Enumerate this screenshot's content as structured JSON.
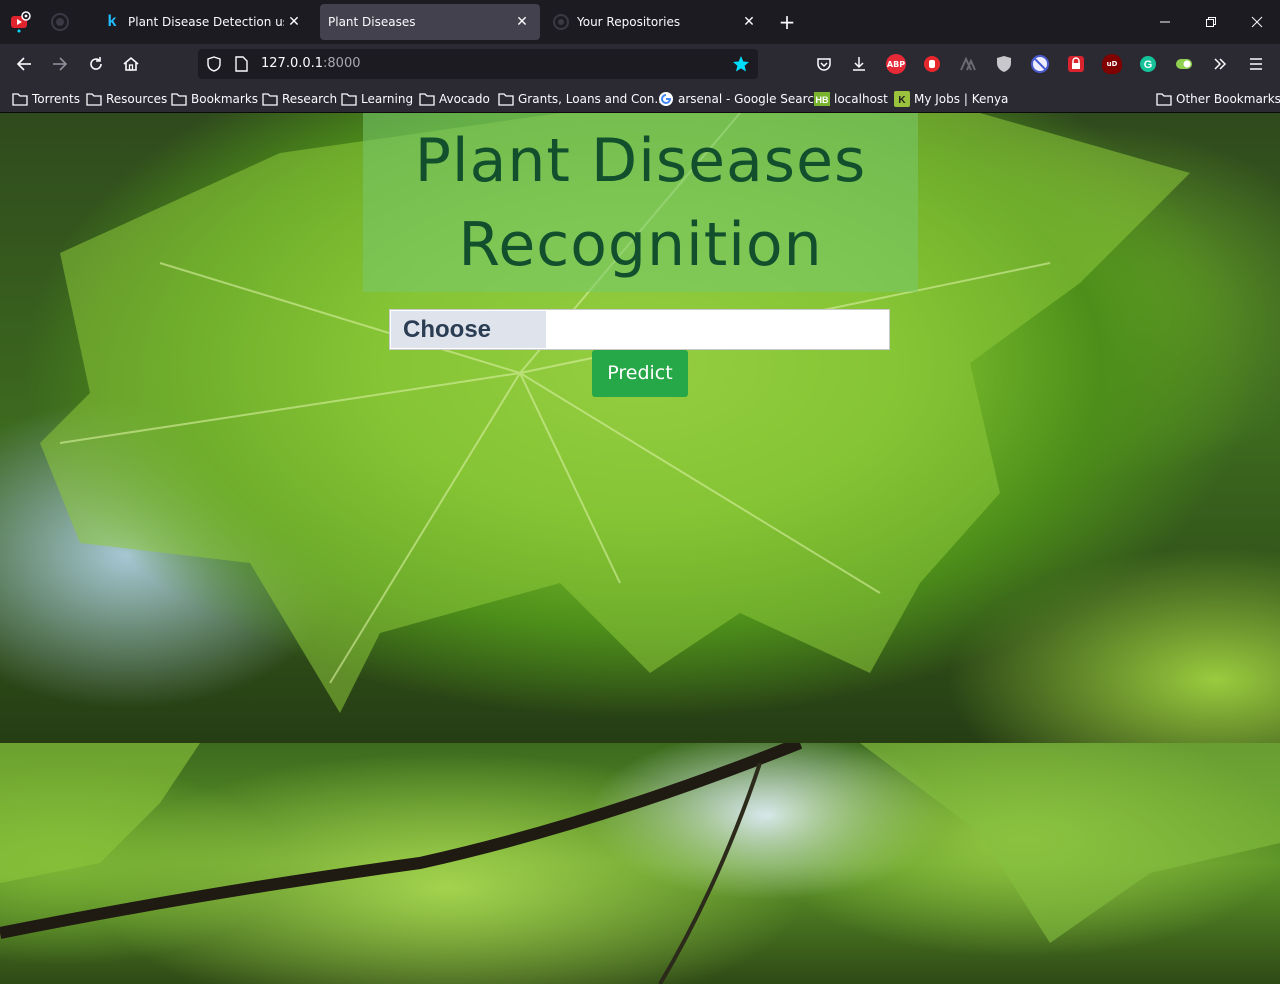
{
  "browser": {
    "tabs": [
      {
        "title": "Plant Disease Detection using Ke",
        "favicon": "kaggle-k",
        "active": false
      },
      {
        "title": "Plant Diseases",
        "favicon": "none",
        "active": true
      },
      {
        "title": "Your Repositories",
        "favicon": "github",
        "active": false
      }
    ],
    "new_tab": "+",
    "url": {
      "host": "127.0.0.1",
      "port": ":8000"
    },
    "bookmarks": [
      {
        "label": "Torrents",
        "icon": "folder-icon"
      },
      {
        "label": "Resources",
        "icon": "folder-icon"
      },
      {
        "label": "Bookmarks",
        "icon": "folder-icon"
      },
      {
        "label": "Research",
        "icon": "folder-icon"
      },
      {
        "label": "Learning",
        "icon": "folder-icon"
      },
      {
        "label": "Avocado",
        "icon": "folder-icon"
      },
      {
        "label": "Grants, Loans and Con...",
        "icon": "folder-icon"
      },
      {
        "label": "arsenal - Google Search",
        "icon": "google-icon"
      },
      {
        "label": "localhost",
        "icon": "hb-icon"
      },
      {
        "label": "My Jobs | Kenya",
        "icon": "k-icon"
      }
    ],
    "other_bookmarks": "Other Bookmarks",
    "extensions": {
      "abp": "ABP",
      "ud": "uD"
    },
    "colors": {
      "tab_bg": "#1c1b22",
      "active_tab": "#42414d",
      "toolbar": "#2b2a33",
      "star": "#0df"
    }
  },
  "page": {
    "title_line1": "Plant Diseases",
    "title_line2": "Recognition",
    "file_button": "Choose",
    "file_name": "",
    "predict_button": "Predict",
    "colors": {
      "title": "#12502d",
      "hero_bg": "rgba(120,200,110,0.55)",
      "predict": "#27a848",
      "choose_bg": "#dfe3eb"
    }
  }
}
